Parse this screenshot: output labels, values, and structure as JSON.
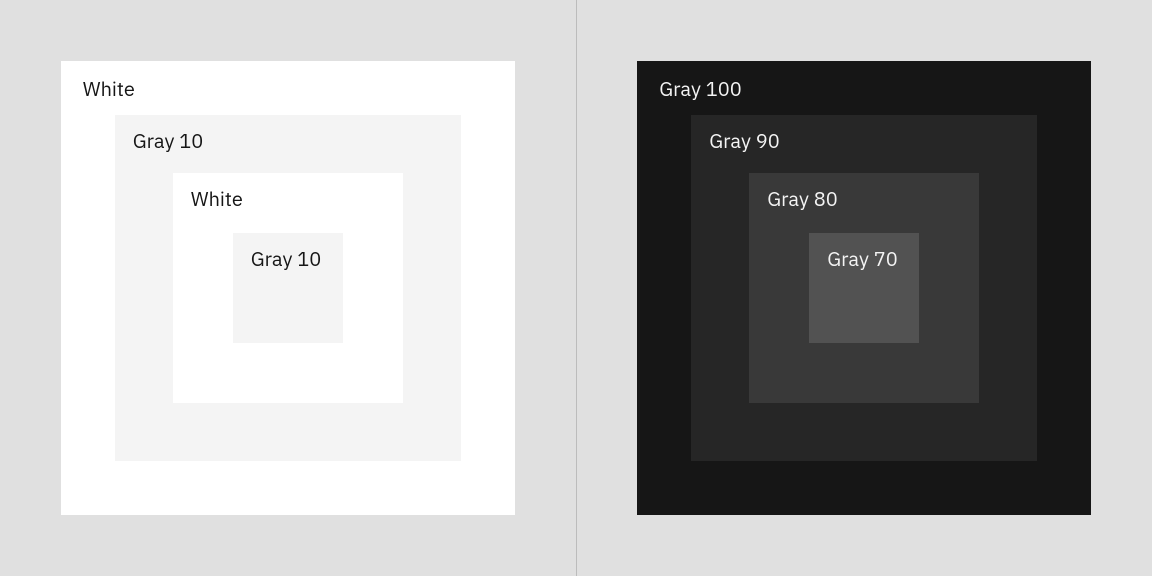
{
  "light": {
    "layers": [
      {
        "label": "White",
        "color": "#ffffff"
      },
      {
        "label": "Gray 10",
        "color": "#f4f4f4"
      },
      {
        "label": "White",
        "color": "#ffffff"
      },
      {
        "label": "Gray 10",
        "color": "#f4f4f4"
      }
    ]
  },
  "dark": {
    "layers": [
      {
        "label": "Gray 100",
        "color": "#161616"
      },
      {
        "label": "Gray 90",
        "color": "#262626"
      },
      {
        "label": "Gray 80",
        "color": "#393939"
      },
      {
        "label": "Gray 70",
        "color": "#525252"
      }
    ]
  }
}
